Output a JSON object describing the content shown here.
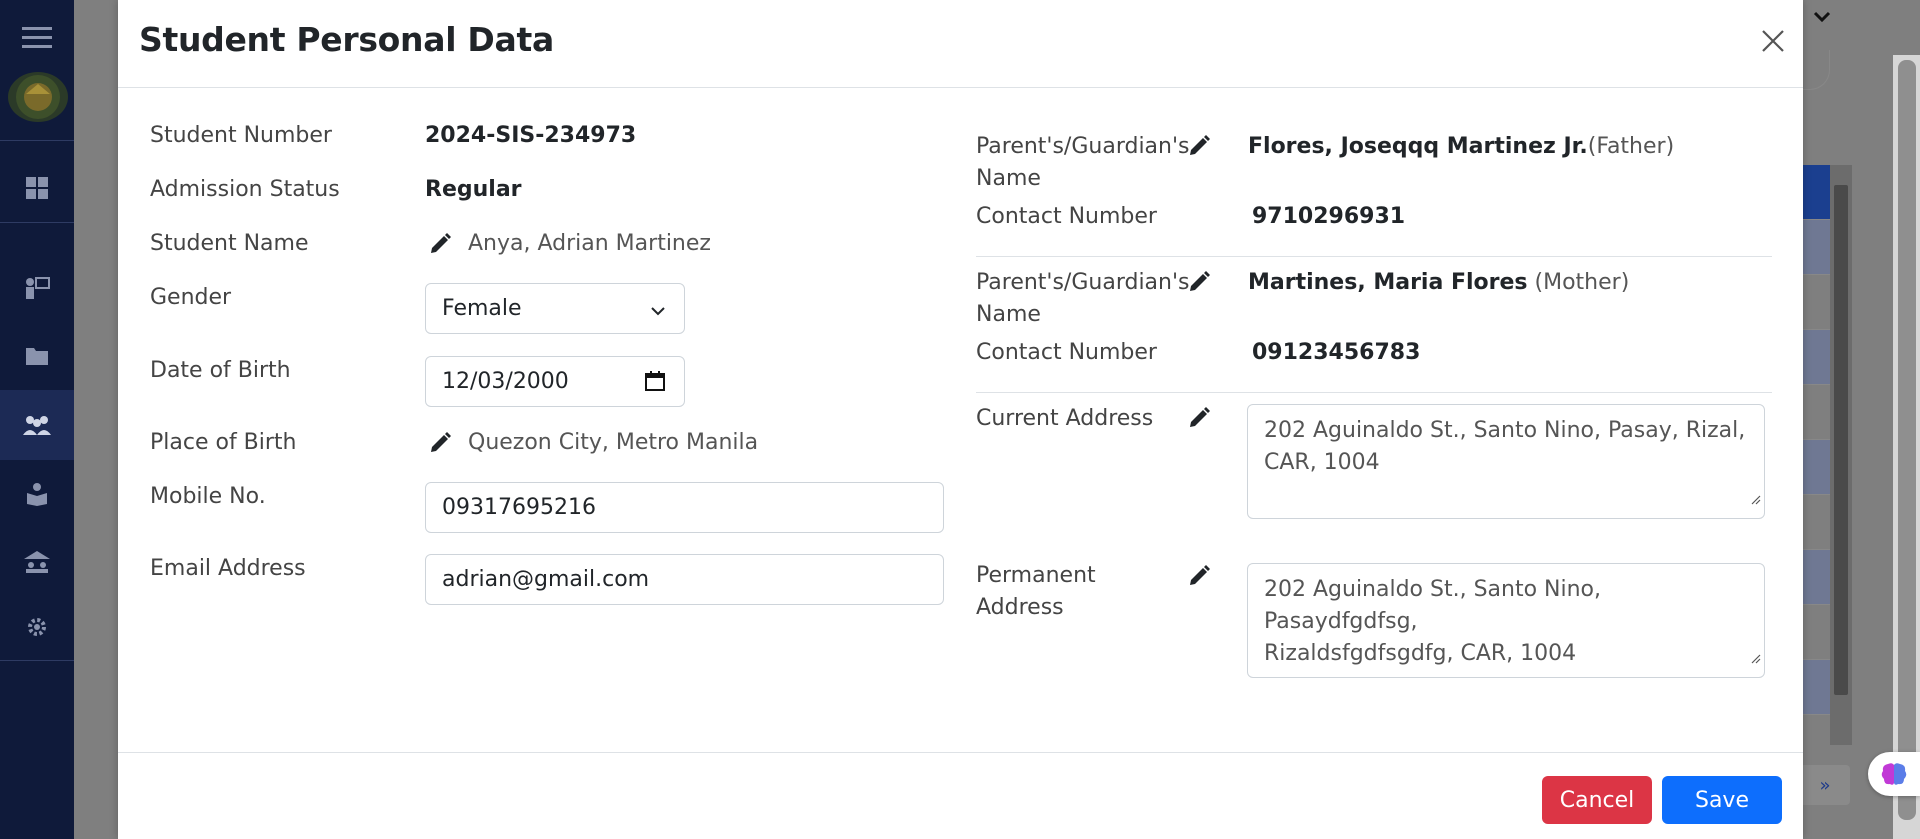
{
  "modal": {
    "title": "Student Personal Data",
    "left": {
      "student_number": {
        "label": "Student Number",
        "value": "2024-SIS-234973"
      },
      "admission_status": {
        "label": "Admission Status",
        "value": "Regular"
      },
      "student_name": {
        "label": "Student Name",
        "value": "Anya, Adrian Martinez"
      },
      "gender": {
        "label": "Gender",
        "value": "Female"
      },
      "date_of_birth": {
        "label": "Date of Birth",
        "value": "12/03/2000"
      },
      "place_of_birth": {
        "label": "Place of Birth",
        "value": "Quezon City, Metro Manila"
      },
      "mobile": {
        "label": "Mobile No.",
        "value": "09317695216"
      },
      "email": {
        "label": "Email Address",
        "value": "adrian@gmail.com"
      }
    },
    "right": {
      "guardian1": {
        "label_line1": "Parent's/Guardian's",
        "label_line2": "Name",
        "name": "Flores, Joseqqq Martinez Jr.",
        "relation": "(Father)",
        "contact_label": "Contact Number",
        "contact": "9710296931"
      },
      "guardian2": {
        "label_line1": "Parent's/Guardian's",
        "label_line2": "Name",
        "name": "Martines, Maria Flores",
        "relation": "(Mother)",
        "contact_label": "Contact Number",
        "contact": "09123456783"
      },
      "current_address": {
        "label": "Current Address",
        "line1": "202 Aguinaldo St., Santo Nino, Pasay, Rizal,",
        "line2": "CAR, 1004"
      },
      "permanent_address": {
        "label_line1": "Permanent",
        "label_line2": "Address",
        "line1": "202 Aguinaldo St., Santo Nino, Pasaydfgdfsg,",
        "line2": "Rizaldsfgdfsgdfg, CAR, 1004"
      }
    },
    "footer": {
      "cancel_label": "Cancel",
      "save_label": "Save"
    }
  },
  "background": {
    "pager_label": "»"
  },
  "colors": {
    "sidebar": "#0f1a3a",
    "danger": "#dc3545",
    "primary": "#0d6efd",
    "overlay": "#7f7f7f"
  },
  "icons": [
    "menu-icon",
    "dashboard-icon",
    "teacher-icon",
    "folder-icon",
    "students-icon",
    "book-reader-icon",
    "school-icon",
    "gear-icon",
    "pencil-icon",
    "close-icon",
    "chevron-down-icon",
    "calendar-icon",
    "brain-icon"
  ]
}
